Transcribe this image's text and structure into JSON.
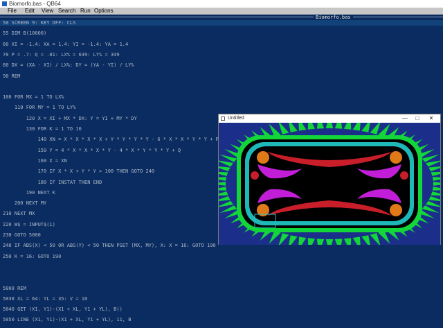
{
  "window": {
    "title": "Biomorfo.bas - QB64"
  },
  "menu": [
    "File",
    "Edit",
    "View",
    "Search",
    "Run",
    "Options"
  ],
  "document": {
    "title": "Biomorfo.bas"
  },
  "code_lines": [
    "50 SCREEN 9: KEY OFF: CLS",
    "55 DIM B(10000)",
    "60 XI = -1.4: XA = 1.4: YI = -1.4: YA = 1.4",
    "70 P = .7: Q = .01: LX% = 639: LY% = 349",
    "80 DX = (XA - XI) / LX%: DY = (YA - YI) / LY%",
    "90 REM",
    "",
    "100 FOR MX = 1 TO LX%",
    "    110 FOR MY = 1 TO LY%",
    "        120 X = XI + MX * DX: Y = YI + MY * DY",
    "        130 FOR K = 1 TO 16",
    "            140 XN = X * X * X * X + Y * Y * Y * Y - 6 * X * X * Y * Y + P",
    "            150 Y = 4 * X * X * X * Y - 4 * X * Y * Y * Y + Q",
    "            160 X = XN",
    "            170 IF X * X + Y * Y > 100 THEN GOTO 240",
    "            180 IF INSTAT THEN END",
    "        190 NEXT K",
    "    200 NEXT MY",
    "210 NEXT MX",
    "220 W$ = INPUT$(1)",
    "230 GOTO 5000",
    "240 IF ABS(X) < 50 OR ABS(Y) < 50 THEN PSET (MX, MY), X: X = 16: GOTO 190",
    "250 K = 16: GOTO 190",
    "",
    "",
    "5000 REM",
    "5030 XL = 64: YL = 35: V = 10",
    "5040 GET (X1, Y1)-(X1 + XL, Y1 + YL), B()",
    "5050 LINE (X1, Y1)-(X1 + XL, Y1 + YL), 11, B"
  ],
  "output_window": {
    "title": "Untitled",
    "minimize": "—",
    "maximize": "□",
    "close": "✕"
  },
  "colors": {
    "editor_bg": "#0b2c60",
    "code_text": "#aeb8c8",
    "fractal_outer": "#1b2f8a",
    "fractal_green": "#12d63a",
    "fractal_cyan": "#1eb8b8",
    "fractal_red": "#c81e2a",
    "fractal_magenta": "#c21ed8",
    "fractal_orange": "#e07a18"
  }
}
